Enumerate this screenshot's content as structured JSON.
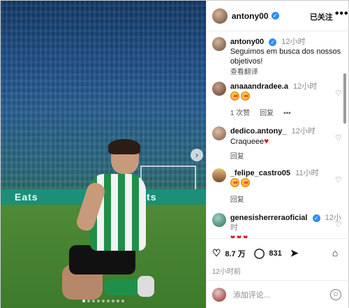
{
  "post": {
    "author": "antony00",
    "follow_label": "已关注",
    "more_label": "•••",
    "caption_time": "12小时",
    "caption": "Seguimos em busca dos nossos objetivos!",
    "translate_label": "查看翻译"
  },
  "photo": {
    "ad_text": "Eats",
    "next_label": "›",
    "slide_count": 9,
    "active_slide": 0
  },
  "comments": [
    {
      "user": "anaaandradee.a",
      "time": "12小时",
      "emoji_count": 2,
      "emoji": "heart-eyes",
      "likes": "1 次赞",
      "reply": "回复",
      "more": "•••"
    },
    {
      "user": "dedico.antony_",
      "time": "12小时",
      "text": "Craqueee",
      "emoji_count": 1,
      "emoji": "red-heart",
      "reply": "回复"
    },
    {
      "user": "_felipe_castro05",
      "time": "11小时",
      "emoji_count": 2,
      "emoji": "heart-eyes",
      "reply": "回复"
    },
    {
      "user": "genesisherreraoficial",
      "time": "12小时",
      "emoji_count": 3,
      "emoji": "red-heart"
    }
  ],
  "actions": {
    "likes": "8.7 万",
    "comments": "831",
    "posted_time": "12小时前"
  },
  "composer": {
    "placeholder": "添加评论..."
  },
  "colors": {
    "accent_blue": "#2f8cff",
    "kit_green": "#1f8f4a",
    "heart_red": "#d11f2e"
  }
}
